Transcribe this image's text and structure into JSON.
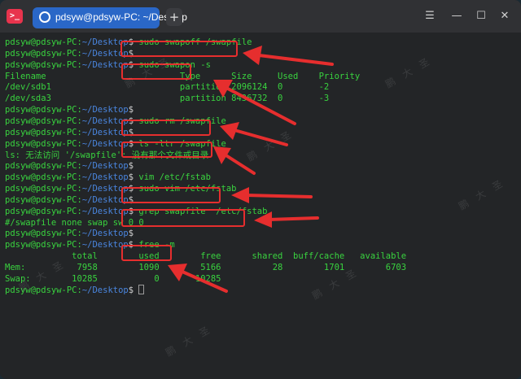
{
  "window": {
    "tab_title": "pdsyw@pdsyw-PC: ~/Desktop",
    "new_tab": "+",
    "controls": {
      "menu": "☰",
      "minimize": "—",
      "maximize": "☐",
      "close": "✕"
    }
  },
  "prompt": {
    "user": "pdsyw@pdsyw-PC",
    "sep": ":",
    "path": "~/Desktop",
    "dollar": "$"
  },
  "lines": [
    {
      "type": "cmd",
      "text": " sudo swapoff /swapfile"
    },
    {
      "type": "cmd",
      "text": ""
    },
    {
      "type": "cmd",
      "text": " sudo swapon -s"
    },
    {
      "type": "out",
      "text": "Filename                          Type      Size     Used    Priority"
    },
    {
      "type": "out",
      "text": "/dev/sdb1                         partition 2096124  0       -2"
    },
    {
      "type": "out",
      "text": "/dev/sda3                         partition 8436732  0       -3"
    },
    {
      "type": "cmd",
      "text": ""
    },
    {
      "type": "cmd",
      "text": " sudo rm /swapfile"
    },
    {
      "type": "cmd",
      "text": ""
    },
    {
      "type": "cmd",
      "text": " ls -ltr /swapfile"
    },
    {
      "type": "out",
      "text": "ls: 无法访问 '/swapfile': 没有那个文件或目录"
    },
    {
      "type": "cmd",
      "text": ""
    },
    {
      "type": "cmd",
      "text": " vim /etc/fstab"
    },
    {
      "type": "cmd",
      "text": " sudo vim /etc/fstab"
    },
    {
      "type": "cmd",
      "text": ""
    },
    {
      "type": "cmd",
      "text": " grep swapfile  /etc/fstab"
    },
    {
      "type": "out",
      "text": "#/swapfile none swap sw 0 0"
    },
    {
      "type": "cmd",
      "text": ""
    },
    {
      "type": "cmd",
      "text": " free -m"
    },
    {
      "type": "out",
      "text": "             total        used        free      shared  buff/cache   available"
    },
    {
      "type": "out",
      "text": "Mem:          7958        1090        5166          28        1701        6703"
    },
    {
      "type": "out",
      "text": "Swap:        10285           0       10285"
    },
    {
      "type": "cmd",
      "text": " "
    }
  ],
  "watermark": "鹏 大 圣",
  "colors": {
    "prompt_green": "#39d33f",
    "path_blue": "#4a86e0",
    "annotation_red": "#e62e2e",
    "tab_blue": "#2a67c7"
  }
}
